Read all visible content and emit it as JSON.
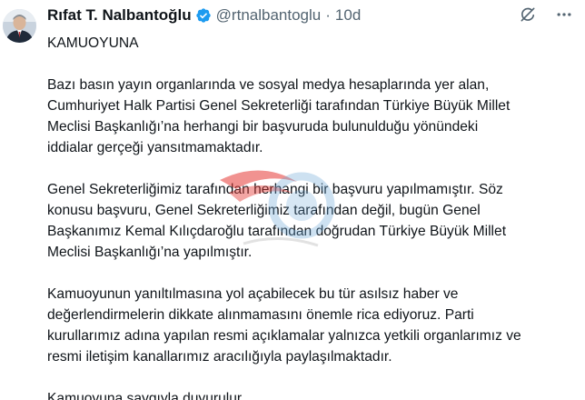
{
  "author": {
    "name": "Rıfat T. Nalbantoğlu",
    "handle": "@rtnalbantoglu",
    "separator": "·",
    "time": "10d",
    "verified_color": "#1d9bf0"
  },
  "icons": {
    "verified": "verified-badge-icon",
    "grok": "grok-icon",
    "more": "more-options-icon",
    "watermark": "news-site-watermark-logo"
  },
  "tweet": {
    "heading": "KAMUOYUNA",
    "paragraphs": [
      {
        "lines": [
          "Bazı basın yayın organlarında ve sosyal medya hesaplarında yer alan,",
          "Cumhuriyet Halk Partisi Genel Sekreterliği tarafından Türkiye Büyük Millet",
          "Meclisi Başkanlığı’na herhangi bir başvuruda bulunulduğu yönündeki",
          "iddialar gerçeği yansıtmamaktadır."
        ]
      },
      {
        "lines": [
          "Genel Sekreterliğimiz tarafından herhangi bir başvuru yapılmamıştır. Söz",
          "konusu başvuru, Genel Sekreterliğimiz tarafından değil, bugün Genel",
          "Başkanımız Kemal Kılıçdaroğlu tarafından doğrudan Türkiye Büyük Millet",
          "Meclisi Başkanlığı’na yapılmıştır."
        ]
      },
      {
        "lines": [
          "Kamuoyunun yanıltılmasına yol açabilecek bu tür asılsız haber ve",
          "değerlendirmelerin dikkate alınmamasını önemle rica ediyoruz. Parti",
          "kurullarımız adına yapılan resmi açıklamalar yalnızca yetkili organlarımız ve",
          "resmi iletişim kanallarımız aracılığıyla paylaşılmaktadır."
        ]
      },
      {
        "lines": [
          "Kamuoyuna saygıyla duyurulur."
        ]
      }
    ]
  }
}
